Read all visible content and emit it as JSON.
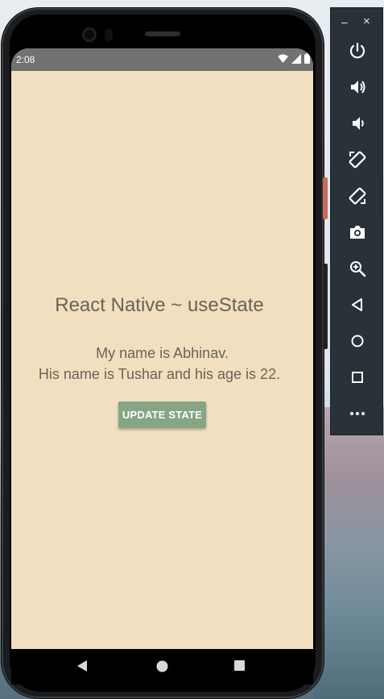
{
  "statusbar": {
    "time": "2:08"
  },
  "app": {
    "title": "React Native ~ useState",
    "line1": "My name is Abhinav.",
    "line2": "His name is Tushar and his age is 22.",
    "button_label": "UPDATE STATE"
  },
  "colors": {
    "app_background": "#f1dfc0",
    "button_background": "#86a584",
    "text": "#6b6356",
    "statusbar": "#737171",
    "toolbar": "#283238"
  },
  "toolbar": {
    "minimize_label": "–",
    "close_label": "×",
    "tools": [
      "power-icon",
      "volume-up-icon",
      "volume-down-icon",
      "rotate-left-icon",
      "rotate-right-icon",
      "camera-icon",
      "zoom-icon",
      "back-icon",
      "home-icon",
      "overview-icon",
      "more-icon"
    ]
  }
}
